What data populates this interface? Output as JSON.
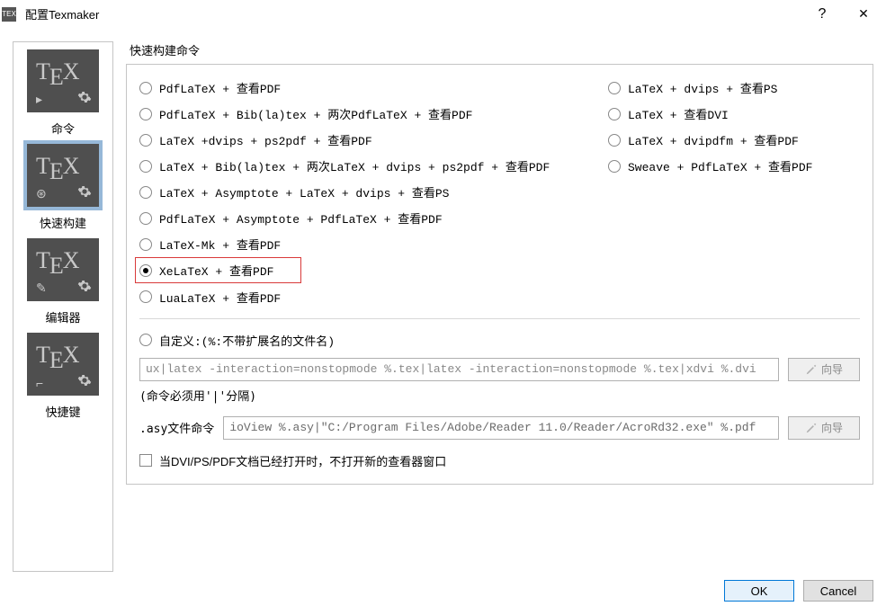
{
  "window": {
    "title": "配置Texmaker",
    "help_icon": "?",
    "close_icon": "✕"
  },
  "sidebar": {
    "items": [
      {
        "label": "命令",
        "mini": "▸"
      },
      {
        "label": "快速构建",
        "mini": "⊛"
      },
      {
        "label": "编辑器",
        "mini": "✎"
      },
      {
        "label": "快捷键",
        "mini": "⌐"
      }
    ]
  },
  "main": {
    "group_title": "快速构建命令",
    "left_options": [
      "PdfLaTeX + 查看PDF",
      "PdfLaTeX + Bib(la)tex + 两次PdfLaTeX + 查看PDF",
      "LaTeX  +dvips + ps2pdf + 查看PDF",
      "LaTeX + Bib(la)tex + 两次LaTeX + dvips + ps2pdf + 查看PDF",
      "LaTeX + Asymptote + LaTeX + dvips + 查看PS",
      "PdfLaTeX + Asymptote + PdfLaTeX + 查看PDF",
      "LaTeX-Mk + 查看PDF",
      "XeLaTeX + 查看PDF",
      "LuaLaTeX + 查看PDF"
    ],
    "right_options": [
      "LaTeX + dvips + 查看PS",
      "LaTeX + 查看DVI",
      "LaTeX + dvipdfm + 查看PDF",
      "Sweave + PdfLaTeX + 查看PDF"
    ],
    "custom_label": "自定义:(%:不带扩展名的文件名)",
    "custom_value": "ux|latex -interaction=nonstopmode %.tex|latex -interaction=nonstopmode %.tex|xdvi %.dvi",
    "wizard": "向导",
    "hint": "(命令必须用'|'分隔)",
    "asy_label": ".asy文件命令",
    "asy_value": "ioView %.asy|\"C:/Program Files/Adobe/Reader 11.0/Reader/AcroRd32.exe\" %.pdf",
    "checkbox_label": "当DVI/PS/PDF文档已经打开时，不打开新的查看器窗口"
  },
  "footer": {
    "ok": "OK",
    "cancel": "Cancel"
  }
}
